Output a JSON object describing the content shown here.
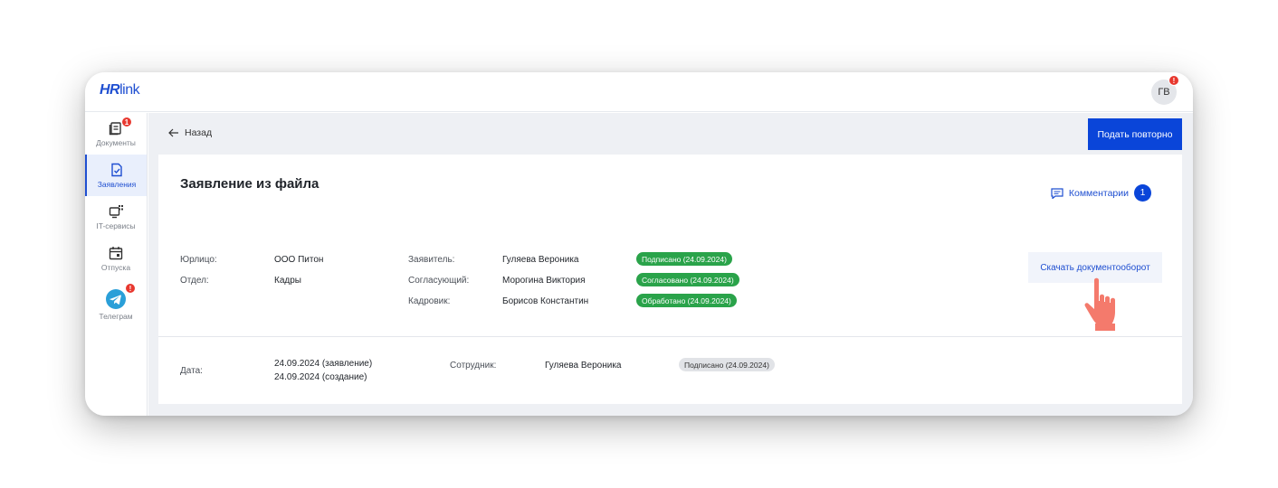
{
  "brand": {
    "logo_hr": "HR",
    "logo_link": "link"
  },
  "user": {
    "initials": "ГВ",
    "alert": "!"
  },
  "sidebar": {
    "items": [
      {
        "label": "Документы",
        "badge": "1"
      },
      {
        "label": "Заявления"
      },
      {
        "label": "IT-сервисы"
      },
      {
        "label": "Отпуска"
      },
      {
        "label": "Телеграм",
        "badge": "!"
      }
    ]
  },
  "header": {
    "back_label": "Назад",
    "resubmit_label": "Подать повторно"
  },
  "card": {
    "title": "Заявление из файла",
    "comments_label": "Комментарии",
    "comments_count": "1",
    "legal_entity_label": "Юрлицо:",
    "legal_entity_value": "ООО Питон",
    "department_label": "Отдел:",
    "department_value": "Кадры",
    "applicant_label": "Заявитель:",
    "applicant_value": "Гуляева Вероника",
    "applicant_status": "Подписано (24.09.2024)",
    "approver_label": "Согласующий:",
    "approver_value": "Морогина Виктория",
    "approver_status": "Согласовано (24.09.2024)",
    "hr_label": "Кадровик:",
    "hr_value": "Борисов Константин",
    "hr_status": "Обработано (24.09.2024)",
    "download_label": "Скачать документооборот",
    "date_label": "Дата:",
    "date_application": "24.09.2024 (заявление)",
    "date_created": "24.09.2024 (создание)",
    "employee_label": "Сотрудник:",
    "employee_value": "Гуляева Вероника",
    "employee_status": "Подписано (24.09.2024)"
  },
  "colors": {
    "accent": "#0a45d9",
    "success": "#2aa34a",
    "alert": "#e8382f",
    "hand": "#f47a6c"
  }
}
